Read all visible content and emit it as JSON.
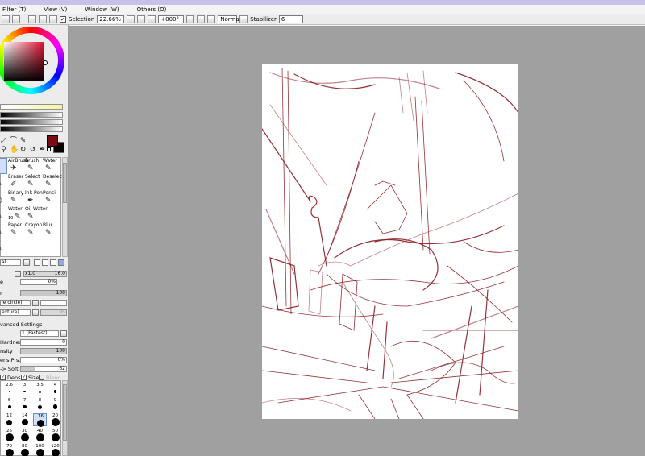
{
  "menubar": {
    "items": [
      "Filter (T)",
      "View (V)",
      "Window (W)",
      "Others (O)"
    ]
  },
  "toolbar": {
    "selection_label": "Selection",
    "zoom_value": "22.66%",
    "rotation_value": "+000°",
    "mode_value": "Normal",
    "stabilizer_label": "Stabilizer",
    "stabilizer_value": "6"
  },
  "colors": {
    "foreground": "#7a0a14",
    "background": "#000000",
    "stroke": "#8a1c24"
  },
  "tools": {
    "brushes": [
      {
        "label": "AirBrush",
        "icon": "airbrush-icon"
      },
      {
        "label": "Brush",
        "icon": "brush-icon"
      },
      {
        "label": "Water",
        "icon": "water-icon"
      },
      {
        "label": "Eraser",
        "icon": "eraser-icon"
      },
      {
        "label": "Select",
        "icon": "select-icon"
      },
      {
        "label": "Deselect",
        "icon": "deselect-icon"
      },
      {
        "label": "Binary",
        "icon": "binary-icon"
      },
      {
        "label": "Ink Pen",
        "icon": "ink-pen-icon"
      },
      {
        "label": "Pencil",
        "icon": "pencil-icon"
      },
      {
        "label": "Water",
        "icon": "water-icon"
      },
      {
        "label": "Oil Water",
        "icon": "oil-water-icon"
      },
      {
        "label": "Paper",
        "icon": "paper-icon"
      },
      {
        "label": "Crayon",
        "icon": "crayon-icon"
      },
      {
        "label": "Blur",
        "icon": "blur-icon"
      }
    ],
    "water_value": "10"
  },
  "properties": {
    "blend_mode": "al",
    "size_multiplier": "x1.0",
    "size_value": "16.0",
    "min_size_label": "e",
    "min_size_value": "0%",
    "density_label": "r",
    "density_value": "100",
    "shape_value": "le circle)",
    "texture_value": "exture)",
    "texture_strength": "95",
    "advanced_label": "vanced Settings",
    "quality_value": "1 (Fastest)",
    "hardness_label": "Hardness",
    "hardness_value": "0",
    "min_density_label": "nsity",
    "min_density_value": "100",
    "max_dens_prs_label": "ens Prs.",
    "max_dens_prs_value": "0%",
    "soft_label": "-> Soft",
    "soft_value": "62",
    "dens_label": "Dens",
    "size_label": "Size",
    "blend_label": "Blend"
  },
  "brush_sizes": [
    {
      "label": "2.6",
      "d": 2
    },
    {
      "label": "3",
      "d": 2.5
    },
    {
      "label": "3.5",
      "d": 3
    },
    {
      "label": "4",
      "d": 3.5
    },
    {
      "label": "6",
      "d": 4
    },
    {
      "label": "7",
      "d": 4.5
    },
    {
      "label": "8",
      "d": 5
    },
    {
      "label": "9",
      "d": 5.5
    },
    {
      "label": "12",
      "d": 7
    },
    {
      "label": "14",
      "d": 8
    },
    {
      "label": "16",
      "d": 9
    },
    {
      "label": "20",
      "d": 10
    },
    {
      "label": "25",
      "d": 10
    },
    {
      "label": "30",
      "d": 10
    },
    {
      "label": "40",
      "d": 10
    },
    {
      "label": "50",
      "d": 10
    },
    {
      "label": "70",
      "d": 10
    },
    {
      "label": "80",
      "d": 10
    },
    {
      "label": "100",
      "d": 10
    },
    {
      "label": "120",
      "d": 10
    }
  ]
}
